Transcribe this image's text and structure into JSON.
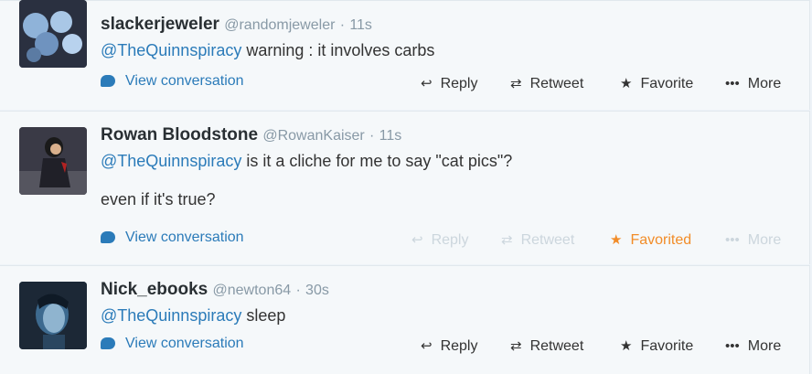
{
  "tweets": [
    {
      "fullname": "slackerjeweler",
      "username": "@randomjeweler",
      "sep": "·",
      "time": "11s",
      "mention": "@TheQuinnspiracy",
      "text": " warning : it involves carbs",
      "text2": "",
      "view_conversation": "View conversation",
      "reply": "Reply",
      "retweet": "Retweet",
      "favorite": "Favorite",
      "more": "More"
    },
    {
      "fullname": "Rowan Bloodstone",
      "username": "@RowanKaiser",
      "sep": "·",
      "time": "11s",
      "mention": "@TheQuinnspiracy",
      "text": " is it a cliche for me to say \"cat pics\"?",
      "text2": "even if it's true?",
      "view_conversation": "View conversation",
      "reply": "Reply",
      "retweet": "Retweet",
      "favorite": "Favorited",
      "more": "More"
    },
    {
      "fullname": "Nick_ebooks",
      "username": "@newton64",
      "sep": "·",
      "time": "30s",
      "mention": "@TheQuinnspiracy",
      "text": " sleep",
      "text2": "",
      "view_conversation": "View conversation",
      "reply": "Reply",
      "retweet": "Retweet",
      "favorite": "Favorite",
      "more": "More"
    }
  ],
  "icons": {
    "reply": "reply-icon",
    "retweet": "retweet-icon",
    "favorite": "star-icon",
    "more": "more-dots-icon",
    "conversation": "speech-bubble-icon"
  },
  "colors": {
    "link": "#2b7bb9",
    "muted": "#ccd6dd",
    "favorited": "#f28c28",
    "background": "#f5f8fa"
  }
}
